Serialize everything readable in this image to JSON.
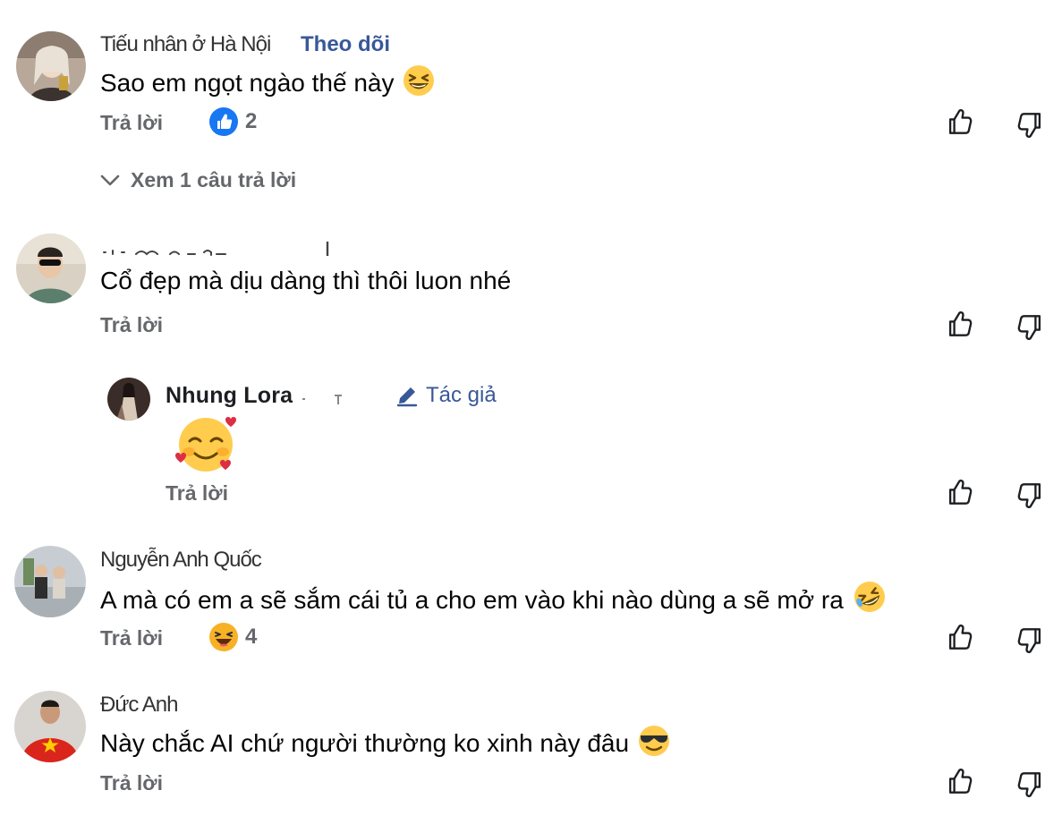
{
  "labels": {
    "reply": "Trả lời",
    "follow": "Theo dõi",
    "author": "Tác giả"
  },
  "comments": [
    {
      "name": "Tiếu nhân ở Hà Nội",
      "text": "Sao em ngọt ngào thế này",
      "emoji": "grinning-squinting-face",
      "reaction": {
        "type": "like",
        "count": "2"
      },
      "view_replies": "Xem 1 câu trả lời"
    },
    {
      "name": "",
      "text": "Cổ đẹp mà dịu dàng thì thôi luon nhé"
    },
    {
      "name": "Nhung Lora",
      "text": "",
      "emoji": "smiling-face-with-hearts"
    },
    {
      "name": "Nguyễn Anh Quốc",
      "text": "A mà có em a sẽ sắm cái tủ a cho em vào khi nào dùng a sẽ mở ra",
      "emoji": "rolling-on-floor-laughing",
      "reaction": {
        "type": "haha",
        "count": "4"
      }
    },
    {
      "name": "Đức Anh",
      "text": "Này chắc AI chứ người thường ko xinh này đâu",
      "emoji": "smiling-face-with-sunglasses"
    }
  ],
  "icons": {
    "like": "thumbs-up-outline-icon",
    "dislike": "thumbs-down-outline-icon",
    "like_reaction": "like-reaction-icon",
    "haha_reaction": "haha-reaction-icon",
    "chevron": "chevron-down-icon",
    "author": "pencil-icon"
  },
  "colors": {
    "link": "#385898",
    "muted": "#65676b",
    "like_blue": "#1877f2",
    "emoji_yellow": "#ffcc4d"
  }
}
